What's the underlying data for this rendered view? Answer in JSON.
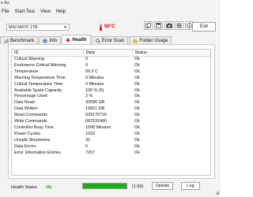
{
  "window": {
    "title_fragment": "e As"
  },
  "menu": [
    "File",
    "Start Test",
    "View",
    "Help"
  ],
  "toolbar": {
    "drive": "MSI M470 1TB",
    "temperature": "56°C",
    "exit_label": "Exit"
  },
  "tabs": [
    {
      "label": "Benchmark",
      "active": false
    },
    {
      "label": "Info",
      "active": false
    },
    {
      "label": "Health",
      "active": true
    },
    {
      "label": "Error Scan",
      "active": false
    },
    {
      "label": "Folder Usage",
      "active": false
    }
  ],
  "table": {
    "columns": [
      "ID",
      "Data",
      "Status"
    ],
    "rows": [
      [
        "Critical Warning",
        "0",
        "Ok"
      ],
      [
        "Endurance Critical Warning",
        "0",
        "Ok"
      ],
      [
        "Temperature",
        "56.0 C",
        "Ok"
      ],
      [
        "Warning Temperature Time",
        "0 Minutes",
        "Ok"
      ],
      [
        "Critical Temperature Time",
        "0 Minutes",
        "Ok"
      ],
      [
        "Available Spare Capacity",
        "100 % (5)",
        "Ok"
      ],
      [
        "Percentage Used",
        "2 %",
        "Ok"
      ],
      [
        "Data Read",
        "30590 GB",
        "Ok"
      ],
      [
        "Data Written",
        "19821 GB",
        "Ok"
      ],
      [
        "Read Commands",
        "539175716",
        "Ok"
      ],
      [
        "Write Commands",
        "687532480",
        "Ok"
      ],
      [
        "Controller Busy Time",
        "1598 Minutes",
        "Ok"
      ],
      [
        "Power Cycles",
        "1319",
        "Ok"
      ],
      [
        "Unsafe Shutdowns",
        "32",
        "Ok"
      ],
      [
        "Data Errors",
        "0",
        "Ok"
      ],
      [
        "Error Information Entries",
        "7207",
        "Ok"
      ]
    ]
  },
  "status": {
    "label": "Health Status",
    "value": "Ok",
    "progress": 1.0,
    "progress_text": "(1:50)",
    "update_label": "Update",
    "log_label": "Log"
  }
}
